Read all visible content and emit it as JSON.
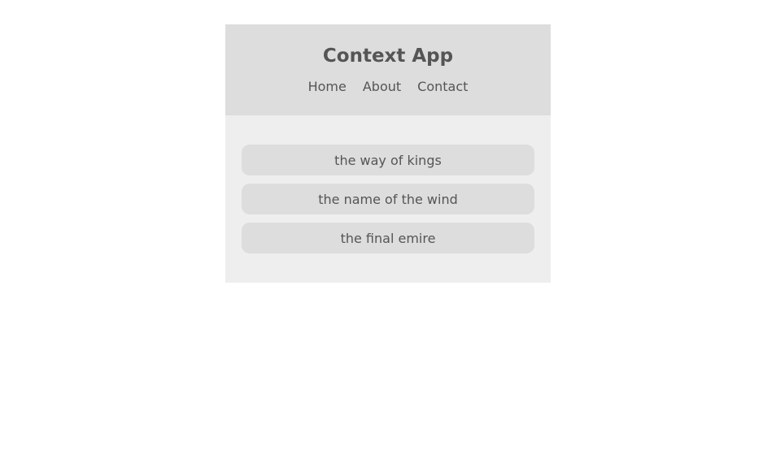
{
  "header": {
    "title": "Context App",
    "nav": [
      "Home",
      "About",
      "Contact"
    ]
  },
  "books": [
    "the way of kings",
    "the name of the wind",
    "the final emire"
  ],
  "colors": {
    "header_bg": "#dddddd",
    "content_bg": "#eeeeee",
    "item_bg": "#dddddd",
    "text": "#555555"
  }
}
